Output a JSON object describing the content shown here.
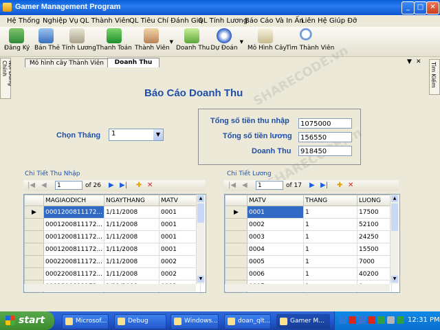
{
  "window": {
    "title": "Gamer Management Program"
  },
  "menu": [
    "Hệ Thống",
    "Nghiệp Vụ",
    "QL Thành Viên",
    "QL Tiêu Chí Đánh Giá",
    "QL Tính Lương",
    "Báo Cáo Và In Ấn",
    "Liên Hệ Giúp Đỡ"
  ],
  "toolbar": [
    {
      "label": "Đăng Ký",
      "icon": "register-icon"
    },
    {
      "label": "Bán Thẻ",
      "icon": "sell-card-icon"
    },
    {
      "label": "Tính Lương",
      "icon": "salary-icon"
    },
    {
      "label": "Thanh Toán",
      "icon": "payment-icon"
    },
    {
      "label": "Thành Viên",
      "icon": "member-icon"
    },
    {
      "label": "Doanh Thu",
      "icon": "revenue-icon"
    },
    {
      "label": "Dự Đoán",
      "icon": "forecast-icon"
    },
    {
      "label": "Mô Hình Cây",
      "icon": "tree-model-icon"
    },
    {
      "label": "Tìm Thành Viên",
      "icon": "search-member-icon"
    }
  ],
  "side": {
    "left": "Nội Dung Chính",
    "right": "Tìm Kiếm"
  },
  "tabs": [
    {
      "label": "Mô hình cây Thành Viên"
    },
    {
      "label": "Doanh Thu"
    }
  ],
  "report": {
    "title": "Báo Cáo Doanh Thu",
    "month_label": "Chọn Tháng",
    "month_value": "1",
    "income_label": "Tổng số tiền thu nhập",
    "income_value": "1075000",
    "salary_label": "Tổng số tiền lương",
    "salary_value": "156550",
    "revenue_label": "Doanh Thu",
    "revenue_value": "918450"
  },
  "income_grid": {
    "caption": "Chi Tiết Thu Nhập",
    "position": "1",
    "count": "of 26",
    "columns": [
      "MAGIAODICH",
      "NGAYTHANG",
      "MATV"
    ],
    "rows": [
      [
        "0001200811172...",
        "1/11/2008",
        "0001"
      ],
      [
        "0001200811172...",
        "1/11/2008",
        "0001"
      ],
      [
        "0001200811172...",
        "1/11/2008",
        "0001"
      ],
      [
        "0001200811172...",
        "1/11/2008",
        "0001"
      ],
      [
        "0002200811172...",
        "1/11/2008",
        "0002"
      ],
      [
        "0002200811172...",
        "1/11/2008",
        "0002"
      ],
      [
        "0002200811172...",
        "1/11/2008",
        "0002"
      ]
    ]
  },
  "salary_grid": {
    "caption": "Chi Tiết Lương",
    "position": "1",
    "count": "of 17",
    "columns": [
      "MATV",
      "THANG",
      "LUONG"
    ],
    "rows": [
      [
        "0001",
        "1",
        "17500"
      ],
      [
        "0002",
        "1",
        "52100"
      ],
      [
        "0003",
        "1",
        "24250"
      ],
      [
        "0004",
        "1",
        "15500"
      ],
      [
        "0005",
        "1",
        "7000"
      ],
      [
        "0006",
        "1",
        "40200"
      ],
      [
        "0007",
        "1",
        "0"
      ]
    ]
  },
  "watermark": "SHARECODE.vn",
  "taskbar": {
    "start": "start",
    "tasks": [
      "Microsof...",
      "Debug",
      "Windows...",
      "doan_qlt...",
      "Gamer M..."
    ],
    "clock": "12:31 PM"
  },
  "colors": {
    "accent": "#1e4fa8",
    "selection": "#316ac5"
  }
}
